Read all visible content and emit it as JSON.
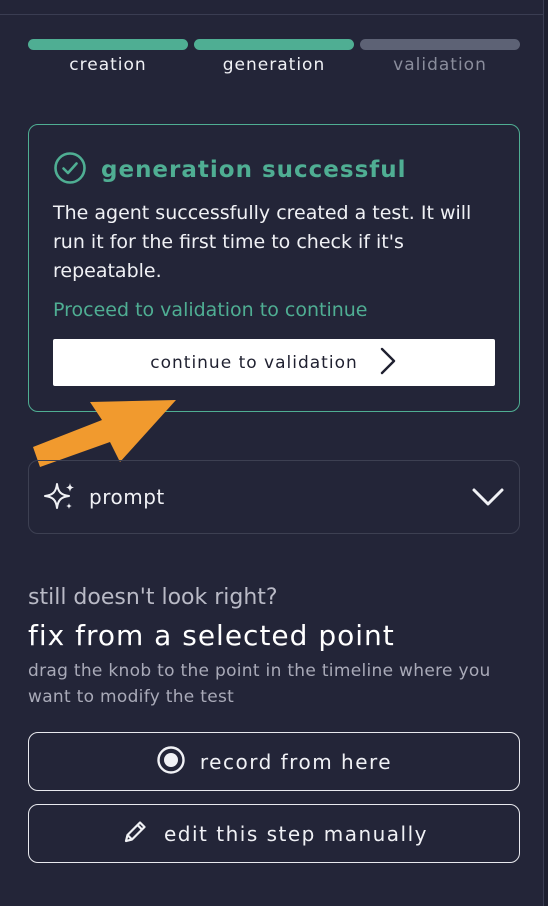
{
  "stepper": {
    "steps": [
      {
        "label": "creation",
        "color": "#4fae93",
        "label_color": "#f0f1f5"
      },
      {
        "label": "generation",
        "color": "#4fae93",
        "label_color": "#f0f1f5"
      },
      {
        "label": "validation",
        "color": "#5d6275",
        "label_color": "#8a8d9c"
      }
    ]
  },
  "success_card": {
    "icon": "check-circle-icon",
    "title": "generation successful",
    "description": "The agent successfully created a test. It will run it for the first time to check if it's repeatable.",
    "hint": "Proceed to validation to continue",
    "button_label": "continue to validation",
    "button_icon": "chevron-right-icon"
  },
  "prompt": {
    "icon": "sparkles-icon",
    "label": "prompt",
    "toggle_icon": "chevron-down-icon"
  },
  "fix": {
    "subtitle": "still doesn't look right?",
    "title": "fix from a selected point",
    "description": "drag the knob to the point in the timeline where you want to modify the test",
    "record_button": {
      "label": "record from here",
      "icon": "record-icon"
    },
    "edit_button": {
      "label": "edit this step manually",
      "icon": "pencil-icon"
    }
  },
  "colors": {
    "background": "#232538",
    "accent": "#4fae93",
    "annotation_arrow": "#f19a2e"
  }
}
